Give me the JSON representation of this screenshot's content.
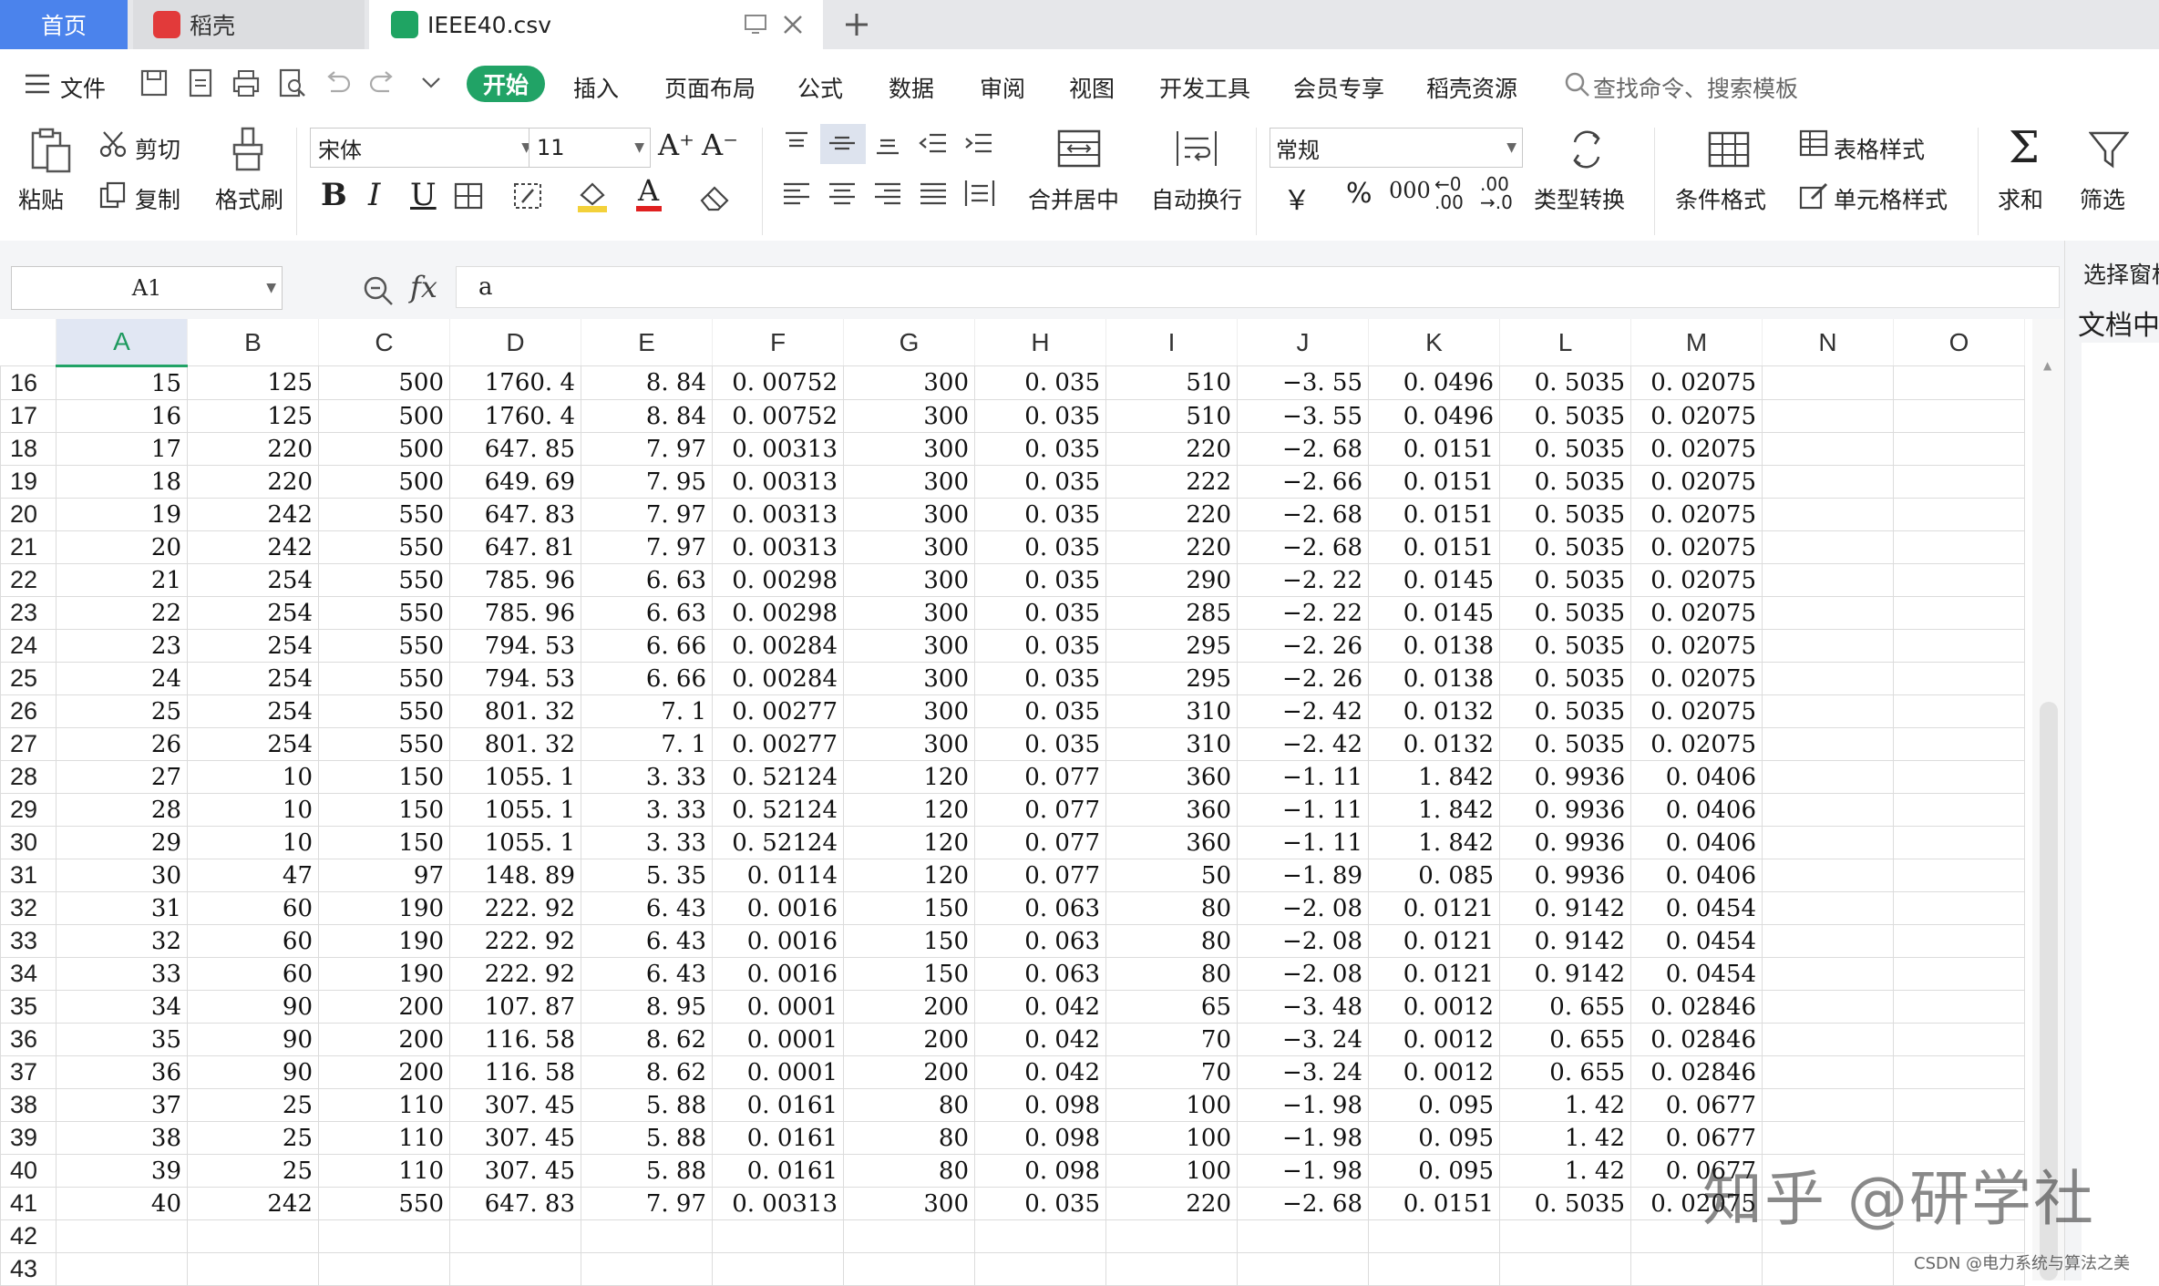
{
  "tabs": {
    "home": "首页",
    "daoke": "稻壳",
    "file": "IEEE40.csv"
  },
  "menu": {
    "file": "文件",
    "items": [
      "开始",
      "插入",
      "页面布局",
      "公式",
      "数据",
      "审阅",
      "视图",
      "开发工具",
      "会员专享",
      "稻壳资源"
    ],
    "search_placeholder": "查找命令、搜索模板"
  },
  "ribbon": {
    "paste": "粘贴",
    "cut": "剪切",
    "copy": "复制",
    "format_painter": "格式刷",
    "font_name": "宋体",
    "font_size": "11",
    "merge_center": "合并居中",
    "wrap_text": "自动换行",
    "number_format": "常规",
    "type_convert": "类型转换",
    "cond_format": "条件格式",
    "table_style": "表格样式",
    "cell_style": "单元格样式",
    "sum": "求和",
    "filter": "筛选",
    "currency": "￥",
    "percent": "%",
    "thousands": "000",
    "inc_dec": "←0 .00",
    "dec_dec": ".00 →.0"
  },
  "formula_bar": {
    "cell_ref": "A1",
    "fx": "fx",
    "content": "a"
  },
  "right_panel": {
    "line1": "选择窗格",
    "line2": "文档中"
  },
  "columns": [
    "A",
    "B",
    "C",
    "D",
    "E",
    "F",
    "G",
    "H",
    "I",
    "J",
    "K",
    "L",
    "M",
    "N",
    "O"
  ],
  "rows": [
    {
      "n": "16",
      "c": [
        "15",
        "125",
        "500",
        "1760. 4",
        "8. 84",
        "0. 00752",
        "300",
        "0. 035",
        "510",
        "−3. 55",
        "0. 0496",
        "0. 5035",
        "0. 02075"
      ]
    },
    {
      "n": "17",
      "c": [
        "16",
        "125",
        "500",
        "1760. 4",
        "8. 84",
        "0. 00752",
        "300",
        "0. 035",
        "510",
        "−3. 55",
        "0. 0496",
        "0. 5035",
        "0. 02075"
      ]
    },
    {
      "n": "18",
      "c": [
        "17",
        "220",
        "500",
        "647. 85",
        "7. 97",
        "0. 00313",
        "300",
        "0. 035",
        "220",
        "−2. 68",
        "0. 0151",
        "0. 5035",
        "0. 02075"
      ]
    },
    {
      "n": "19",
      "c": [
        "18",
        "220",
        "500",
        "649. 69",
        "7. 95",
        "0. 00313",
        "300",
        "0. 035",
        "222",
        "−2. 66",
        "0. 0151",
        "0. 5035",
        "0. 02075"
      ]
    },
    {
      "n": "20",
      "c": [
        "19",
        "242",
        "550",
        "647. 83",
        "7. 97",
        "0. 00313",
        "300",
        "0. 035",
        "220",
        "−2. 68",
        "0. 0151",
        "0. 5035",
        "0. 02075"
      ]
    },
    {
      "n": "21",
      "c": [
        "20",
        "242",
        "550",
        "647. 81",
        "7. 97",
        "0. 00313",
        "300",
        "0. 035",
        "220",
        "−2. 68",
        "0. 0151",
        "0. 5035",
        "0. 02075"
      ]
    },
    {
      "n": "22",
      "c": [
        "21",
        "254",
        "550",
        "785. 96",
        "6. 63",
        "0. 00298",
        "300",
        "0. 035",
        "290",
        "−2. 22",
        "0. 0145",
        "0. 5035",
        "0. 02075"
      ]
    },
    {
      "n": "23",
      "c": [
        "22",
        "254",
        "550",
        "785. 96",
        "6. 63",
        "0. 00298",
        "300",
        "0. 035",
        "285",
        "−2. 22",
        "0. 0145",
        "0. 5035",
        "0. 02075"
      ]
    },
    {
      "n": "24",
      "c": [
        "23",
        "254",
        "550",
        "794. 53",
        "6. 66",
        "0. 00284",
        "300",
        "0. 035",
        "295",
        "−2. 26",
        "0. 0138",
        "0. 5035",
        "0. 02075"
      ]
    },
    {
      "n": "25",
      "c": [
        "24",
        "254",
        "550",
        "794. 53",
        "6. 66",
        "0. 00284",
        "300",
        "0. 035",
        "295",
        "−2. 26",
        "0. 0138",
        "0. 5035",
        "0. 02075"
      ]
    },
    {
      "n": "26",
      "c": [
        "25",
        "254",
        "550",
        "801. 32",
        "7. 1",
        "0. 00277",
        "300",
        "0. 035",
        "310",
        "−2. 42",
        "0. 0132",
        "0. 5035",
        "0. 02075"
      ]
    },
    {
      "n": "27",
      "c": [
        "26",
        "254",
        "550",
        "801. 32",
        "7. 1",
        "0. 00277",
        "300",
        "0. 035",
        "310",
        "−2. 42",
        "0. 0132",
        "0. 5035",
        "0. 02075"
      ]
    },
    {
      "n": "28",
      "c": [
        "27",
        "10",
        "150",
        "1055. 1",
        "3. 33",
        "0. 52124",
        "120",
        "0. 077",
        "360",
        "−1. 11",
        "1. 842",
        "0. 9936",
        "0. 0406"
      ]
    },
    {
      "n": "29",
      "c": [
        "28",
        "10",
        "150",
        "1055. 1",
        "3. 33",
        "0. 52124",
        "120",
        "0. 077",
        "360",
        "−1. 11",
        "1. 842",
        "0. 9936",
        "0. 0406"
      ]
    },
    {
      "n": "30",
      "c": [
        "29",
        "10",
        "150",
        "1055. 1",
        "3. 33",
        "0. 52124",
        "120",
        "0. 077",
        "360",
        "−1. 11",
        "1. 842",
        "0. 9936",
        "0. 0406"
      ]
    },
    {
      "n": "31",
      "c": [
        "30",
        "47",
        "97",
        "148. 89",
        "5. 35",
        "0. 0114",
        "120",
        "0. 077",
        "50",
        "−1. 89",
        "0. 085",
        "0. 9936",
        "0. 0406"
      ]
    },
    {
      "n": "32",
      "c": [
        "31",
        "60",
        "190",
        "222. 92",
        "6. 43",
        "0. 0016",
        "150",
        "0. 063",
        "80",
        "−2. 08",
        "0. 0121",
        "0. 9142",
        "0. 0454"
      ]
    },
    {
      "n": "33",
      "c": [
        "32",
        "60",
        "190",
        "222. 92",
        "6. 43",
        "0. 0016",
        "150",
        "0. 063",
        "80",
        "−2. 08",
        "0. 0121",
        "0. 9142",
        "0. 0454"
      ]
    },
    {
      "n": "34",
      "c": [
        "33",
        "60",
        "190",
        "222. 92",
        "6. 43",
        "0. 0016",
        "150",
        "0. 063",
        "80",
        "−2. 08",
        "0. 0121",
        "0. 9142",
        "0. 0454"
      ]
    },
    {
      "n": "35",
      "c": [
        "34",
        "90",
        "200",
        "107. 87",
        "8. 95",
        "0. 0001",
        "200",
        "0. 042",
        "65",
        "−3. 48",
        "0. 0012",
        "0. 655",
        "0. 02846"
      ]
    },
    {
      "n": "36",
      "c": [
        "35",
        "90",
        "200",
        "116. 58",
        "8. 62",
        "0. 0001",
        "200",
        "0. 042",
        "70",
        "−3. 24",
        "0. 0012",
        "0. 655",
        "0. 02846"
      ]
    },
    {
      "n": "37",
      "c": [
        "36",
        "90",
        "200",
        "116. 58",
        "8. 62",
        "0. 0001",
        "200",
        "0. 042",
        "70",
        "−3. 24",
        "0. 0012",
        "0. 655",
        "0. 02846"
      ]
    },
    {
      "n": "38",
      "c": [
        "37",
        "25",
        "110",
        "307. 45",
        "5. 88",
        "0. 0161",
        "80",
        "0. 098",
        "100",
        "−1. 98",
        "0. 095",
        "1. 42",
        "0. 0677"
      ]
    },
    {
      "n": "39",
      "c": [
        "38",
        "25",
        "110",
        "307. 45",
        "5. 88",
        "0. 0161",
        "80",
        "0. 098",
        "100",
        "−1. 98",
        "0. 095",
        "1. 42",
        "0. 0677"
      ]
    },
    {
      "n": "40",
      "c": [
        "39",
        "25",
        "110",
        "307. 45",
        "5. 88",
        "0. 0161",
        "80",
        "0. 098",
        "100",
        "−1. 98",
        "0. 095",
        "1. 42",
        "0. 0677"
      ]
    },
    {
      "n": "41",
      "c": [
        "40",
        "242",
        "550",
        "647. 83",
        "7. 97",
        "0. 00313",
        "300",
        "0. 035",
        "220",
        "−2. 68",
        "0. 0151",
        "0. 5035",
        "0. 02075"
      ]
    },
    {
      "n": "42",
      "c": []
    },
    {
      "n": "43",
      "c": []
    }
  ],
  "watermark": "知乎 @研学社",
  "credit": "CSDN @电力系统与算法之美",
  "colors": {
    "accent": "#21a366",
    "home_tab": "#4b83ec",
    "selected_col_bg": "#e1e7f3"
  }
}
